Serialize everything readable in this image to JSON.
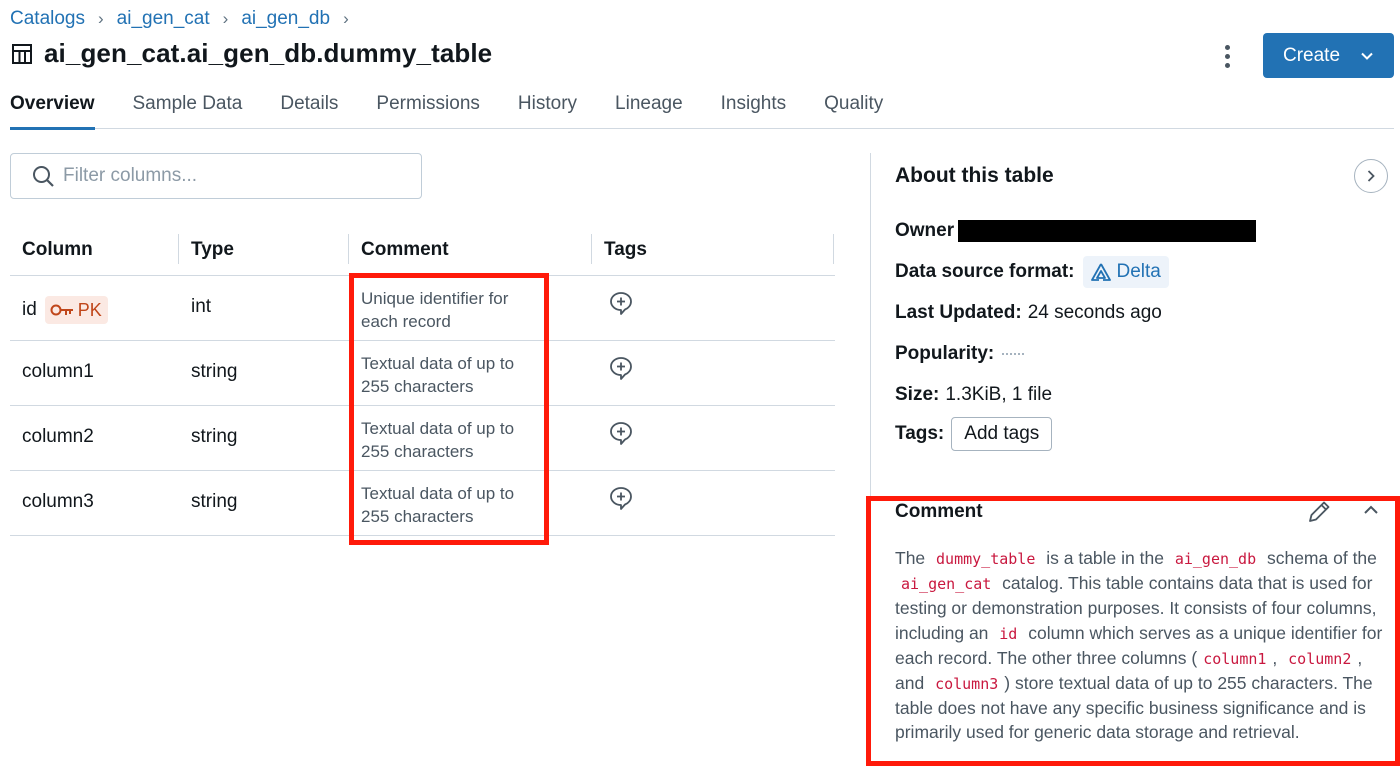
{
  "breadcrumb": [
    "Catalogs",
    "ai_gen_cat",
    "ai_gen_db"
  ],
  "breadcrumb_separator": "›",
  "title": "ai_gen_cat.ai_gen_db.dummy_table",
  "create_button": "Create",
  "tabs": [
    {
      "label": "Overview",
      "active": true
    },
    {
      "label": "Sample Data",
      "active": false
    },
    {
      "label": "Details",
      "active": false
    },
    {
      "label": "Permissions",
      "active": false
    },
    {
      "label": "History",
      "active": false
    },
    {
      "label": "Lineage",
      "active": false
    },
    {
      "label": "Insights",
      "active": false
    },
    {
      "label": "Quality",
      "active": false
    }
  ],
  "filter": {
    "placeholder": "Filter columns...",
    "value": ""
  },
  "columns_table": {
    "headers": [
      "Column",
      "Type",
      "Comment",
      "Tags"
    ],
    "rows": [
      {
        "name": "id",
        "badge": "PK",
        "type": "int",
        "comment": "Unique identifier for each record"
      },
      {
        "name": "column1",
        "badge": "",
        "type": "string",
        "comment": "Textual data of up to 255 characters"
      },
      {
        "name": "column2",
        "badge": "",
        "type": "string",
        "comment": "Textual data of up to 255 characters"
      },
      {
        "name": "column3",
        "badge": "",
        "type": "string",
        "comment": "Textual data of up to 255 characters"
      }
    ]
  },
  "about": {
    "title": "About this table",
    "owner_label": "Owner",
    "source_label": "Data source format:",
    "source_value": "Delta",
    "updated_label": "Last Updated:",
    "updated_value": "24 seconds ago",
    "popularity_label": "Popularity:",
    "size_label": "Size:",
    "size_value": "1.3KiB, 1 file",
    "tags_label": "Tags:",
    "add_tags": "Add tags"
  },
  "comment": {
    "heading": "Comment",
    "parts": [
      {
        "t": "text",
        "v": "The "
      },
      {
        "t": "code",
        "v": "dummy_table"
      },
      {
        "t": "text",
        "v": " is a table in the "
      },
      {
        "t": "code",
        "v": "ai_gen_db"
      },
      {
        "t": "text",
        "v": " schema of the "
      },
      {
        "t": "code",
        "v": "ai_gen_cat"
      },
      {
        "t": "text",
        "v": " catalog. This table contains data that is used for testing or demonstration purposes. It consists of four columns, including an "
      },
      {
        "t": "code",
        "v": "id"
      },
      {
        "t": "text",
        "v": " column which serves as a unique identifier for each record. The other three columns ("
      },
      {
        "t": "code",
        "v": "column1"
      },
      {
        "t": "text",
        "v": ", "
      },
      {
        "t": "code",
        "v": "column2"
      },
      {
        "t": "text",
        "v": ", and "
      },
      {
        "t": "code",
        "v": "column3"
      },
      {
        "t": "text",
        "v": ") store textual data of up to 255 characters. The table does not have any specific business significance and is primarily used for generic data storage and retrieval."
      }
    ]
  },
  "colors": {
    "accent": "#2272b4",
    "highlight_border": "#ff1a0a",
    "code": "#c9183f",
    "pk_bg": "#fbe9e3",
    "pk_text": "#c0461a"
  },
  "icons": [
    "table-icon",
    "kebab-menu-icon",
    "chevron-down-icon",
    "search-icon",
    "key-icon",
    "add-tag-icon",
    "chevron-right-icon",
    "delta-icon",
    "pencil-icon",
    "chevron-up-icon"
  ]
}
